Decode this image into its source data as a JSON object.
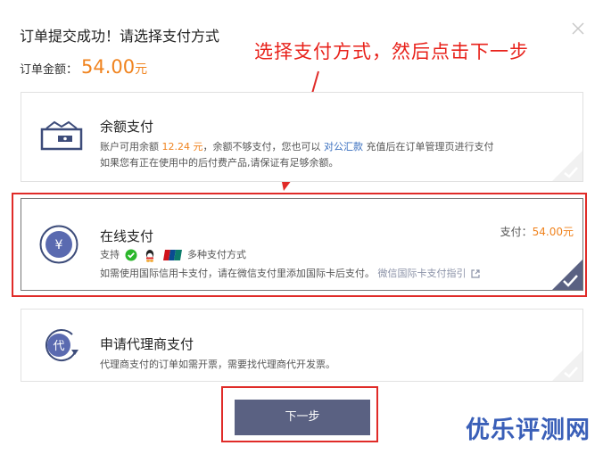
{
  "dialog": {
    "title": "订单提交成功！请选择支付方式",
    "amount_label": "订单金额：",
    "amount_value": "54.00",
    "amount_unit": "元"
  },
  "annotation": {
    "text": "选择支付方式，然后点击下一步"
  },
  "options": [
    {
      "name": "余额支付",
      "line1_a": "账户可用余额",
      "line1_balance": "12.24 元",
      "line1_b": "，余额不够支付，您也可以",
      "line1_link": "对公汇款",
      "line1_c": "充值后在订单管理页进行支付",
      "line2": "如果您有正在使用中的后付费产品,请保证有足够余额。"
    },
    {
      "name": "在线支付",
      "support_label": "支持",
      "support_more": "多种支付方式",
      "line2": "如需使用国际信用卡支付，请在微信支付里添加国际卡后支付。",
      "line2_link": "微信国际卡支付指引",
      "pay_label": "支付：",
      "pay_value": "54.00元"
    },
    {
      "name": "申请代理商支付",
      "line1": "代理商支付的订单如需开票，需要找代理商代开发票。",
      "icon_char": "代"
    }
  ],
  "online_icon_char": "¥",
  "next_button": {
    "label": "下一步"
  },
  "watermark": {
    "text": "优乐评测网"
  },
  "colors": {
    "accent_orange": "#f0831e",
    "button_bg": "#5a6182",
    "highlight_red": "#e02b28",
    "link_blue": "#3a6fbf"
  }
}
